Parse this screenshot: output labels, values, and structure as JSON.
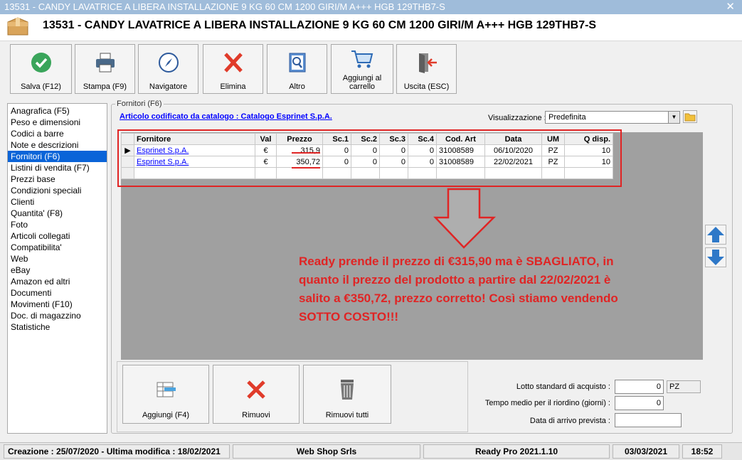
{
  "window": {
    "title": "13531 - CANDY LAVATRICE A LIBERA INSTALLAZIONE 9 KG 60 CM 1200 GIRI/M  A+++ HGB 129THB7-S",
    "close_glyph": "✕"
  },
  "header": {
    "title": "13531 - CANDY LAVATRICE A LIBERA INSTALLAZIONE 9 KG 60 CM 1200 GIRI/M  A+++ HGB 129THB7-S"
  },
  "toolbar": {
    "buttons": [
      {
        "label": "Salva (F12)",
        "icon": "check-circle-icon"
      },
      {
        "label": "Stampa (F9)",
        "icon": "printer-icon"
      },
      {
        "label": "Navigatore",
        "icon": "compass-icon"
      },
      {
        "label": "Elimina",
        "icon": "x-icon"
      },
      {
        "label": "Altro",
        "icon": "book-search-icon"
      },
      {
        "label": "Aggiungi al carrello",
        "icon": "cart-icon"
      },
      {
        "label": "Uscita (ESC)",
        "icon": "exit-door-icon"
      }
    ]
  },
  "nav": {
    "items": [
      "Anagrafica (F5)",
      "Peso e dimensioni",
      "Codici a barre",
      "Note e descrizioni",
      "Fornitori (F6)",
      "Listini di vendita (F7)",
      "Prezzi base",
      "Condizioni speciali",
      "Clienti",
      "Quantita' (F8)",
      "Foto",
      "Articoli collegati",
      "Compatibilita'",
      "Web",
      "eBay",
      "Amazon ed altri",
      "Documenti",
      "Movimenti (F10)",
      "Doc. di magazzino",
      "Statistiche"
    ],
    "selected_index": 4
  },
  "fornitori": {
    "group_title": "Fornitori (F6)",
    "catalog_link": "Articolo codificato da catalogo : Catalogo Esprinet S.p.A.",
    "visualizzazione_label": "Visualizzazione :",
    "visualizzazione_value": "Predefinita",
    "columns": [
      "Fornitore",
      "Val",
      "Prezzo",
      "Sc.1",
      "Sc.2",
      "Sc.3",
      "Sc.4",
      "Cod. Art",
      "Data",
      "UM",
      "Q disp."
    ],
    "rows": [
      [
        "Esprinet S.p.A.",
        "€",
        "315,9",
        "0",
        "0",
        "0",
        "0",
        "31008589",
        "06/10/2020",
        "PZ",
        "10"
      ],
      [
        "Esprinet S.p.A.",
        "€",
        "350,72",
        "0",
        "0",
        "0",
        "0",
        "31008589",
        "22/02/2021",
        "PZ",
        "10"
      ]
    ]
  },
  "annotation": {
    "line1": "Ready prende il prezzo di €315,90 ma è SBAGLIATO, in",
    "line2": "quanto il prezzo del prodotto a partire dal 22/02/2021 è",
    "line3": "salito a €350,72, prezzo corretto! Così stiamo vendendo",
    "line4": "SOTTO COSTO!!!",
    "color": "#e02424"
  },
  "bottom_buttons": [
    {
      "label": "Aggiungi (F4)",
      "icon": "add-row-icon"
    },
    {
      "label": "Rimuovi",
      "icon": "x-icon"
    },
    {
      "label": "Rimuovi tutti",
      "icon": "trash-icon"
    }
  ],
  "fields": {
    "lotto_label": "Lotto standard di acquisto :",
    "lotto_value": "0",
    "lotto_um": "PZ",
    "tempo_label": "Tempo medio per il riordino (giorni) :",
    "tempo_value": "0",
    "data_label": "Data di arrivo prevista :",
    "data_value": ""
  },
  "status": {
    "creation": "Creazione : 25/07/2020 - Ultima modifica : 18/02/2021",
    "company": "Web Shop Srls",
    "version": "Ready Pro 2021.1.10",
    "date": "03/03/2021",
    "time": "18:52"
  }
}
